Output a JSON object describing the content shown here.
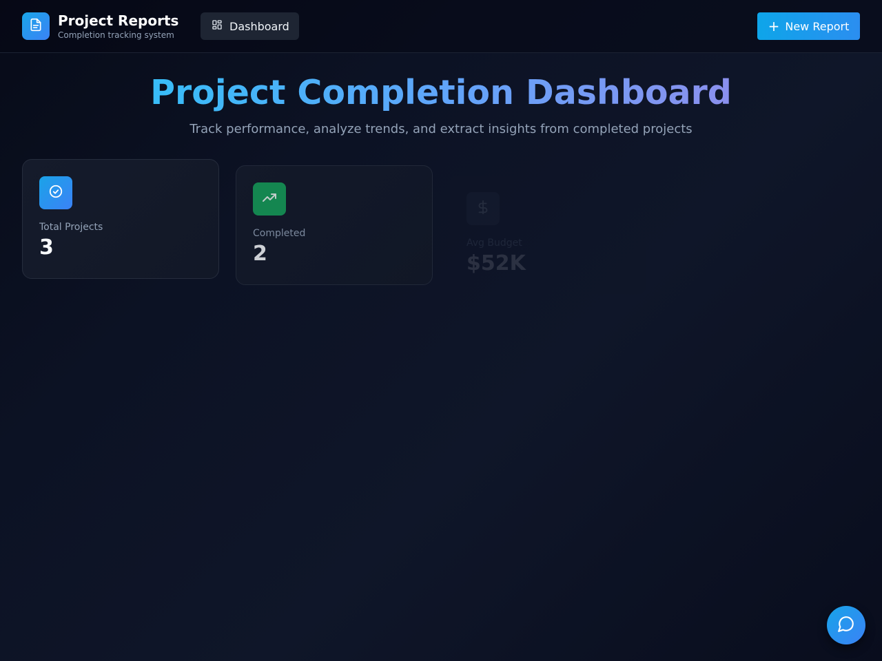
{
  "header": {
    "app_title": "Project Reports",
    "app_subtitle": "Completion tracking system",
    "logo_icon": "document-icon",
    "nav": [
      {
        "label": "Dashboard",
        "icon": "dashboard-grid-icon",
        "active": true
      }
    ],
    "new_report_button": {
      "label": "New Report",
      "icon": "plus-icon"
    }
  },
  "hero": {
    "title": "Project Completion Dashboard",
    "subtitle": "Track performance, analyze trends, and extract insights from completed projects"
  },
  "stats": [
    {
      "label": "Total Projects",
      "value": "3",
      "icon": "check-circle-icon",
      "color": "#1aa3e8"
    },
    {
      "label": "Completed",
      "value": "2",
      "icon": "trending-up-icon",
      "color": "#16a05a"
    },
    {
      "label": "Avg Budget",
      "value": "$52K",
      "icon": "dollar-icon",
      "color": "#3a4256"
    }
  ],
  "chat_button": {
    "icon": "chat-bubble-icon"
  },
  "colors": {
    "accent": "#0ea5e9",
    "background": "#0c1224",
    "success": "#16a05a"
  }
}
